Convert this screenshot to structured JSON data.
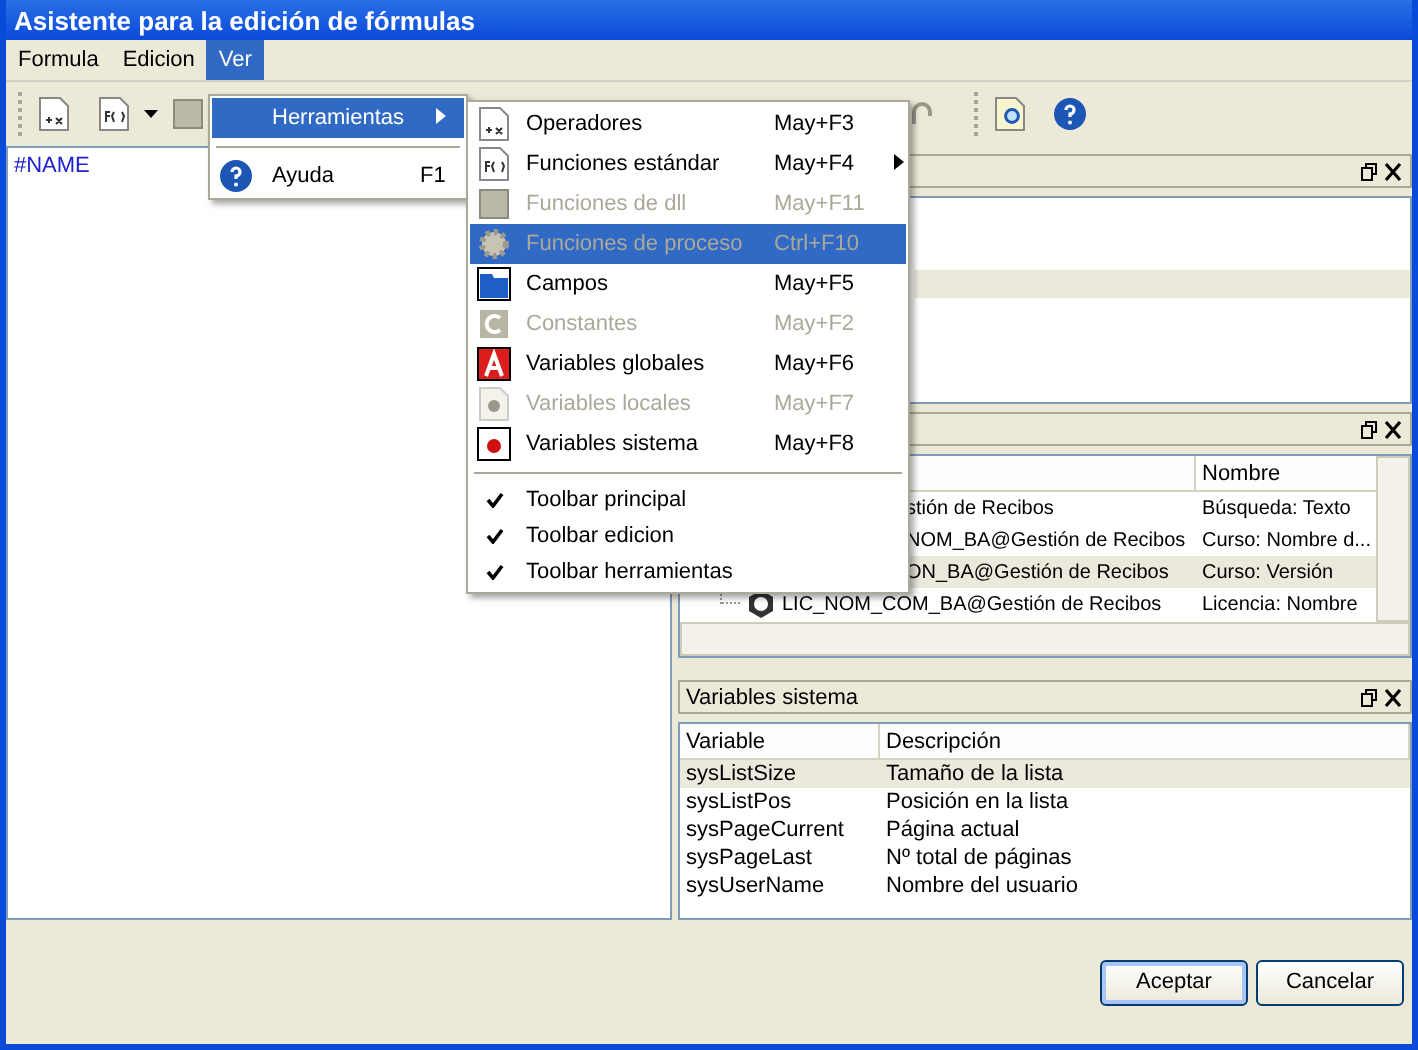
{
  "window": {
    "title": "Asistente para la edición de fórmulas"
  },
  "menubar": [
    {
      "label": "Formula",
      "selected": false
    },
    {
      "label": "Edicion",
      "selected": false
    },
    {
      "label": "Ver",
      "selected": true
    }
  ],
  "ver_menu": [
    {
      "label": "Herramientas",
      "submenu": true,
      "selected": true
    },
    {
      "label": "Ayuda",
      "shortcut": "F1",
      "submenu": false,
      "selected": false
    }
  ],
  "herramientas_menu": [
    {
      "kind": "item",
      "label": "Operadores",
      "shortcut": "May+F3",
      "disabled": false,
      "selected": false,
      "submenu": false
    },
    {
      "kind": "item",
      "label": "Funciones estándar",
      "shortcut": "May+F4",
      "disabled": false,
      "selected": false,
      "submenu": true
    },
    {
      "kind": "item",
      "label": "Funciones de dll",
      "shortcut": "May+F11",
      "disabled": true,
      "selected": false,
      "submenu": false
    },
    {
      "kind": "item",
      "label": "Funciones de proceso",
      "shortcut": "Ctrl+F10",
      "disabled": true,
      "selected": true,
      "submenu": false
    },
    {
      "kind": "item",
      "label": "Campos",
      "shortcut": "May+F5",
      "disabled": false,
      "selected": false,
      "submenu": false
    },
    {
      "kind": "item",
      "label": "Constantes",
      "shortcut": "May+F2",
      "disabled": true,
      "selected": false,
      "submenu": false
    },
    {
      "kind": "item",
      "label": "Variables globales",
      "shortcut": "May+F6",
      "disabled": false,
      "selected": false,
      "submenu": false
    },
    {
      "kind": "item",
      "label": "Variables locales",
      "shortcut": "May+F7",
      "disabled": true,
      "selected": false,
      "submenu": false
    },
    {
      "kind": "item",
      "label": "Variables sistema",
      "shortcut": "May+F8",
      "disabled": false,
      "selected": false,
      "submenu": false
    },
    {
      "kind": "separator"
    },
    {
      "kind": "check",
      "label": "Toolbar principal",
      "checked": true
    },
    {
      "kind": "check",
      "label": "Toolbar edicion",
      "checked": true
    },
    {
      "kind": "check",
      "label": "Toolbar herramientas",
      "checked": true
    }
  ],
  "editor": {
    "value": "#NAME"
  },
  "panel_1": {
    "rows": [
      {
        "selected": false
      },
      {
        "selected": false
      },
      {
        "selected": true
      }
    ]
  },
  "panel_2": {
    "columns": [
      "Nombre"
    ],
    "rows": [
      {
        "kind": "clipped",
        "column_1": "stión de Recibos",
        "nombre": "Búsqueda: Texto",
        "selected": false
      },
      {
        "kind": "clipped",
        "column_1": "NOM_BA@Gestión de Recibos",
        "nombre": "Curso: Nombre d...",
        "selected": false
      },
      {
        "kind": "clipped",
        "column_1": "ON_BA@Gestión de Recibos",
        "nombre": "Curso: Versión",
        "selected": true
      },
      {
        "kind": "node",
        "column_1": "LIC_NOM_COM_BA@Gestión de Recibos",
        "nombre": "Licencia: Nombre",
        "selected": false
      }
    ]
  },
  "panel_3": {
    "title": "Variables sistema",
    "columns": [
      "Variable",
      "Descripción"
    ],
    "rows": [
      {
        "variable": "sysListSize",
        "descripcion": "Tamaño de la lista",
        "selected": true
      },
      {
        "variable": "sysListPos",
        "descripcion": "Posición en la lista",
        "selected": false
      },
      {
        "variable": "sysPageCurrent",
        "descripcion": "Página actual",
        "selected": false
      },
      {
        "variable": "sysPageLast",
        "descripcion": "Nº total de páginas",
        "selected": false
      },
      {
        "variable": "sysUserName",
        "descripcion": "Nombre del usuario",
        "selected": false
      }
    ]
  },
  "buttons": [
    {
      "label": "Aceptar",
      "default": true
    },
    {
      "label": "Cancelar",
      "default": false
    }
  ]
}
